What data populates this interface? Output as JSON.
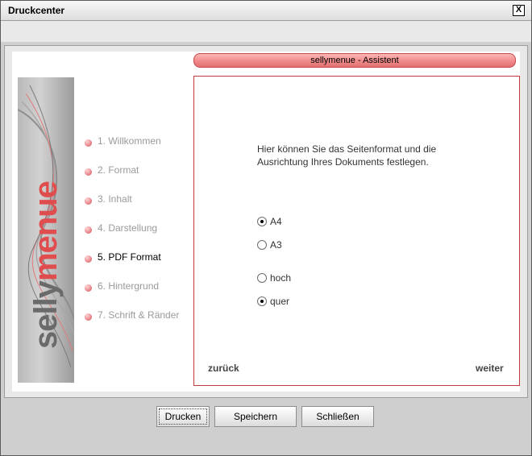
{
  "window": {
    "title": "Druckcenter",
    "close_label": "X"
  },
  "banner": {
    "title": "sellymenue - Assistent"
  },
  "logo": {
    "text_a": "selly",
    "text_b": "menue"
  },
  "steps": [
    {
      "label": "1. Willkommen",
      "active": false
    },
    {
      "label": "2. Format",
      "active": false
    },
    {
      "label": "3. Inhalt",
      "active": false
    },
    {
      "label": "4. Darstellung",
      "active": false
    },
    {
      "label": "5. PDF Format",
      "active": true
    },
    {
      "label": "6. Hintergrund",
      "active": false
    },
    {
      "label": "7. Schrift & Ränder",
      "active": false
    }
  ],
  "content": {
    "description": "Hier können Sie das Seitenformat und die Ausrichtung Ihres Dokuments festlegen.",
    "format_options": [
      {
        "label": "A4",
        "selected": true
      },
      {
        "label": "A3",
        "selected": false
      }
    ],
    "orientation_options": [
      {
        "label": "hoch",
        "selected": false
      },
      {
        "label": "quer",
        "selected": true
      }
    ],
    "back_label": "zurück",
    "next_label": "weiter"
  },
  "buttons": {
    "print": "Drucken",
    "save": "Speichern",
    "close": "Schließen"
  }
}
